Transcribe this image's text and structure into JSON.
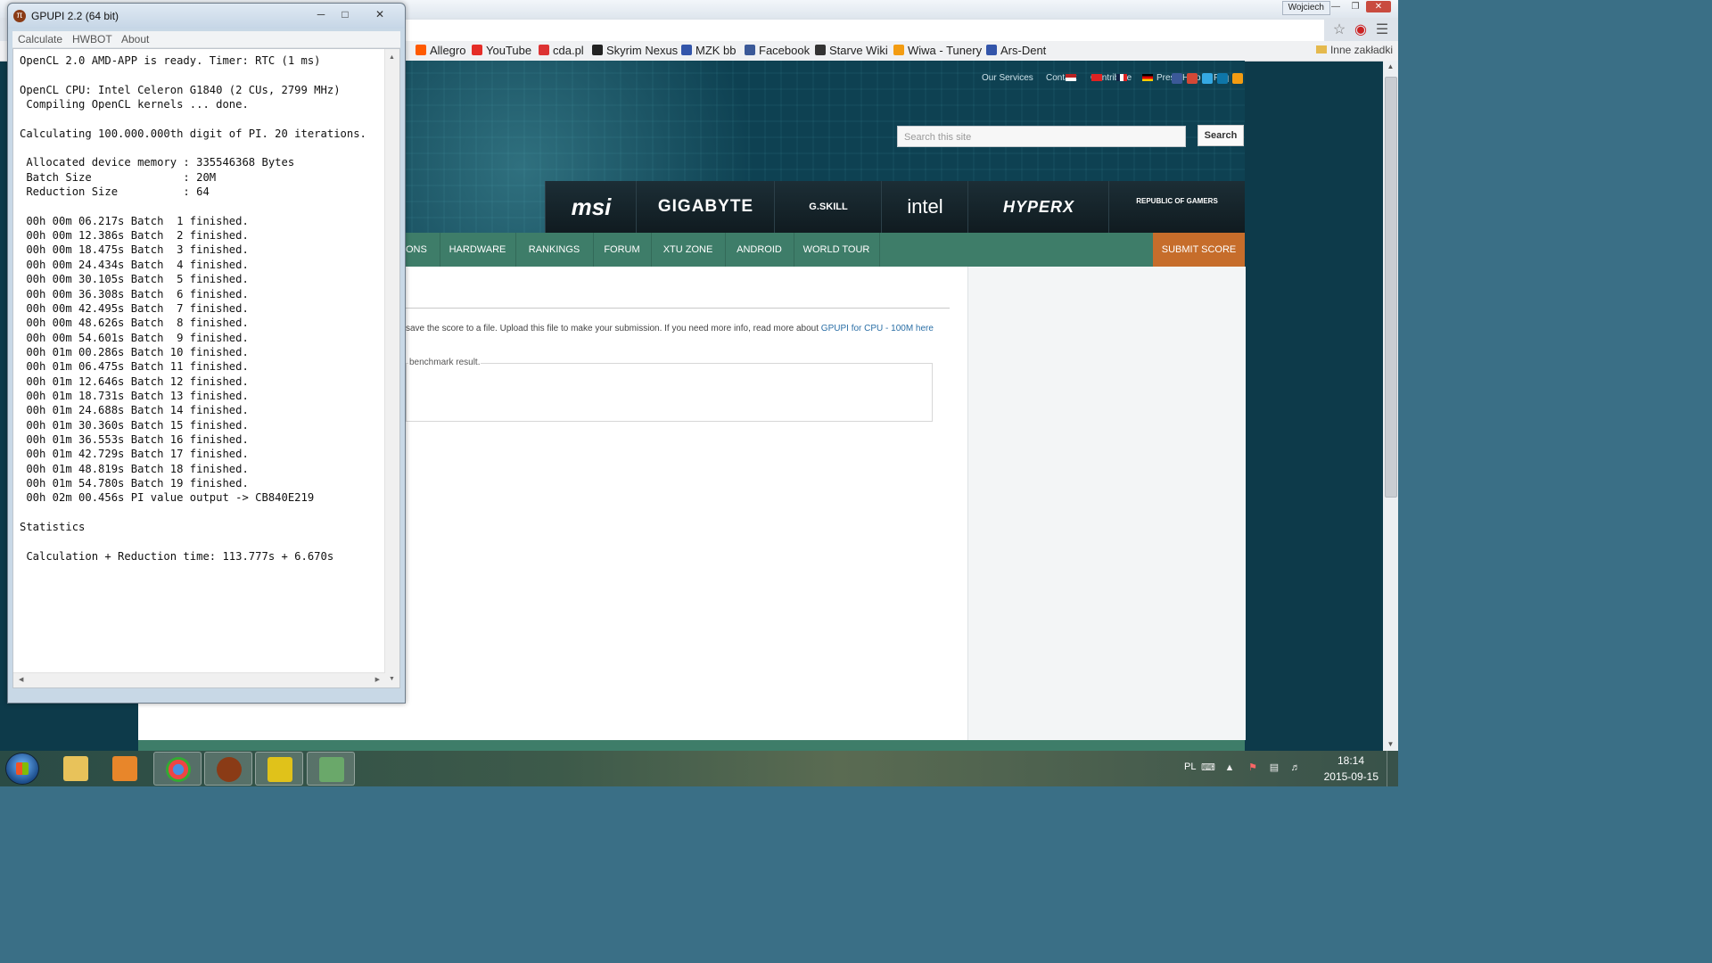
{
  "browser": {
    "window_user": "Wojciech",
    "bookmarks": [
      {
        "label": "Allegro",
        "icon": "allegro-icon",
        "color": "#ff5a00"
      },
      {
        "label": "YouTube",
        "icon": "youtube-icon",
        "color": "#e52d27"
      },
      {
        "label": "cda.pl",
        "icon": "cda-icon",
        "color": "#d33"
      },
      {
        "label": "Skyrim Nexus",
        "icon": "nexus-icon",
        "color": "#222"
      },
      {
        "label": "MZK bb",
        "icon": "mzk-icon",
        "color": "#3355aa"
      },
      {
        "label": "Facebook",
        "icon": "facebook-icon",
        "color": "#3b5998"
      },
      {
        "label": "Starve Wiki",
        "icon": "starve-icon",
        "color": "#333"
      },
      {
        "label": "Wiwa - Tunery",
        "icon": "wiwa-icon",
        "color": "#f39c12"
      },
      {
        "label": "Ars-Dent",
        "icon": "arsdent-icon",
        "color": "#3355aa"
      }
    ],
    "other_bookmarks": "Inne zakładki"
  },
  "site": {
    "top_links": [
      "Our Services",
      "Contact",
      "Contribute",
      "Press",
      "Help",
      "Faq"
    ],
    "search_placeholder": "Search this site",
    "search_button": "Search",
    "sponsors": [
      "msi",
      "GIGABYTE",
      "G.SKILL",
      "intel",
      "HYPERX",
      "REPUBLIC OF GAMERS"
    ],
    "nav": [
      "ONS",
      "HARDWARE",
      "RANKINGS",
      "FORUM",
      "XTU ZONE",
      "ANDROID",
      "WORLD TOUR"
    ],
    "submit_score": "SUBMIT SCORE",
    "info_text": "save the score to a file. Upload this file to make your submission. If you need more info, read more about ",
    "info_link": "GPUPI for CPU - 100M here",
    "legend": "benchmark result."
  },
  "gpupi": {
    "title": "GPUPI 2.2 (64 bit)",
    "menu": [
      "Calculate",
      "HWBOT",
      "About"
    ],
    "output": "OpenCL 2.0 AMD-APP is ready. Timer: RTC (1 ms)\n\nOpenCL CPU: Intel Celeron G1840 (2 CUs, 2799 MHz)\n Compiling OpenCL kernels ... done.\n\nCalculating 100.000.000th digit of PI. 20 iterations.\n\n Allocated device memory : 335546368 Bytes\n Batch Size              : 20M\n Reduction Size          : 64\n\n 00h 00m 06.217s Batch  1 finished.\n 00h 00m 12.386s Batch  2 finished.\n 00h 00m 18.475s Batch  3 finished.\n 00h 00m 24.434s Batch  4 finished.\n 00h 00m 30.105s Batch  5 finished.\n 00h 00m 36.308s Batch  6 finished.\n 00h 00m 42.495s Batch  7 finished.\n 00h 00m 48.626s Batch  8 finished.\n 00h 00m 54.601s Batch  9 finished.\n 00h 01m 00.286s Batch 10 finished.\n 00h 01m 06.475s Batch 11 finished.\n 00h 01m 12.646s Batch 12 finished.\n 00h 01m 18.731s Batch 13 finished.\n 00h 01m 24.688s Batch 14 finished.\n 00h 01m 30.360s Batch 15 finished.\n 00h 01m 36.553s Batch 16 finished.\n 00h 01m 42.729s Batch 17 finished.\n 00h 01m 48.819s Batch 18 finished.\n 00h 01m 54.780s Batch 19 finished.\n 00h 02m 00.456s PI value output -> CB840E219\n\nStatistics\n\n Calculation + Reduction time: 113.777s + 6.670s"
  },
  "taskbar": {
    "apps": [
      {
        "name": "explorer-icon",
        "color": "#e8c25a"
      },
      {
        "name": "media-player-icon",
        "color": "#e8862a"
      },
      {
        "name": "chrome-icon",
        "color": "#4a8fe0"
      },
      {
        "name": "gpupi-icon",
        "color": "#8a3b16"
      },
      {
        "name": "asrock-cpu-icon",
        "color": "#e0c21a"
      },
      {
        "name": "snipping-tool-icon",
        "color": "#6aa86a"
      }
    ],
    "lang": "PL",
    "time": "18:14",
    "date": "2015-09-15"
  }
}
